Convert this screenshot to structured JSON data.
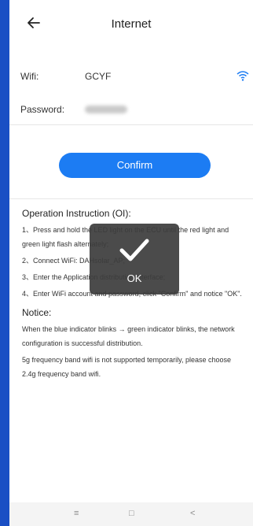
{
  "header": {
    "title": "Internet",
    "back_icon": "arrow-left-icon"
  },
  "form": {
    "wifi_label": "Wifi:",
    "wifi_value": "GCYF",
    "wifi_icon": "wifi-icon",
    "password_label": "Password:",
    "confirm_label": "Confirm"
  },
  "instructions": {
    "heading": "Operation Instruction (OI):",
    "steps": [
      "1、Press and hold the LED light on the ECU until the red light and green light flash alternately;",
      "2、Connect WiFi: DAHsolar_AP;",
      "3、Enter the Application distribution interface;",
      "4、Enter WiFi account and password, click \"Confirm\" and notice \"OK\"."
    ],
    "notice_title": "Notice:",
    "notices": [
      "When the blue indicator blinks → green indicator blinks, the network configuration is successful distribution.",
      "5g frequency band wifi is not supported temporarily, please choose 2.4g frequency band wifi."
    ]
  },
  "toast": {
    "text": "OK",
    "icon": "checkmark-icon"
  },
  "navbar": {
    "menu": "≡",
    "home": "□",
    "back": "<"
  },
  "colors": {
    "accent": "#1c7cf3",
    "frame": "#1a4fc4"
  }
}
